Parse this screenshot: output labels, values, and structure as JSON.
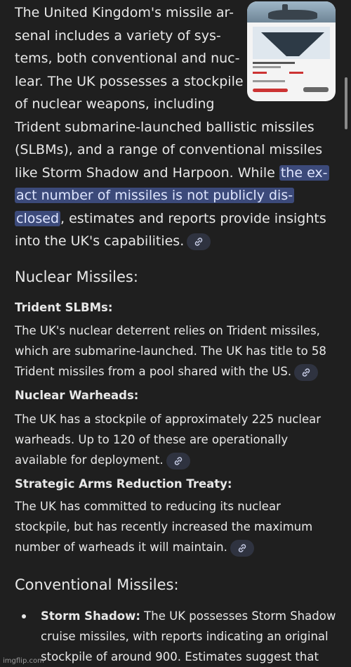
{
  "intro": {
    "lines": [
      "The United Kingdom's missile ar-",
      "senal includes a variety of sys-",
      "tems, both conventional and nuc-",
      "lear. The UK possesses a stockpile",
      "of nuclear weapons, including",
      "Trident submarine-launched ballistic missiles",
      "(SLBMs), and a range of conventional missiles",
      "like Storm Shadow and Harpoon. While "
    ],
    "highlight_1": "the ex-",
    "highlight_2": "act number of missiles is not publicly dis-",
    "highlight_3": "closed",
    "line_after_highlight": ", estimates and reports provide insights",
    "last_line": "into the UK's capabilities."
  },
  "thumbnail": {
    "icon": "infographic-thumbnail"
  },
  "nuclear": {
    "heading": "Nuclear Missiles:",
    "trident": {
      "title": "Trident SLBMs:",
      "lines": [
        "The UK's nuclear deterrent relies on Trident missiles,",
        "which are submarine-launched. The UK has title to 58",
        "Trident missiles from a pool shared with the US."
      ]
    },
    "warheads": {
      "title": "Nuclear Warheads:",
      "lines": [
        "The UK has a stockpile of approximately 225 nuclear",
        "warheads. Up to 120 of these are operationally",
        "available for deployment."
      ]
    },
    "treaty": {
      "title": "Strategic Arms Reduction Treaty:",
      "lines": [
        "The UK has committed to reducing its nuclear",
        "stockpile, but has recently increased the maximum",
        "number of warheads it will maintain."
      ]
    }
  },
  "conventional": {
    "heading": "Conventional Missiles:",
    "bullet": {
      "bold": "Storm Shadow:",
      "line1_rest": " The UK possesses Storm Shadow",
      "line2": "cruise missiles, with reports indicating an original",
      "line3": "stockpile of around 900. Estimates suggest that"
    }
  },
  "watermark": "imgflip.com",
  "icons": {
    "link": "link-icon",
    "bullet": "bullet-dot"
  },
  "colors": {
    "background": "#1f1f1f",
    "text": "#e8e8e8",
    "highlight": "#3c4a7a",
    "chip": "#2f3340"
  }
}
